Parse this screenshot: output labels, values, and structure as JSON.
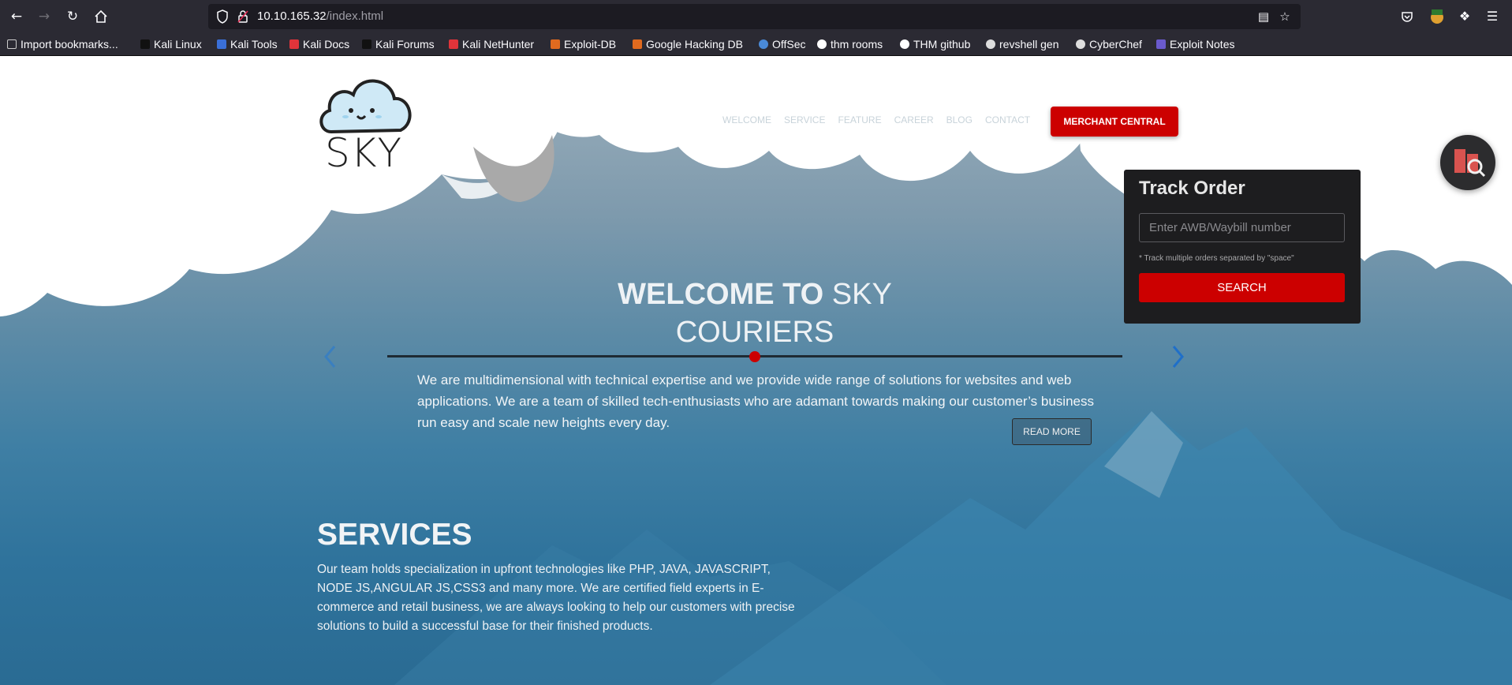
{
  "browser": {
    "url_host": "10.10.165.32",
    "url_path": "/index.html",
    "bookmarks": [
      {
        "label": "Import bookmarks...",
        "color": "#cccccc"
      },
      {
        "label": "Kali Linux",
        "color": "#1a1a1a"
      },
      {
        "label": "Kali Tools",
        "color": "#3a6fd8"
      },
      {
        "label": "Kali Docs",
        "color": "#e0343a"
      },
      {
        "label": "Kali Forums",
        "color": "#1a1a1a"
      },
      {
        "label": "Kali NetHunter",
        "color": "#e0343a"
      },
      {
        "label": "Exploit-DB",
        "color": "#e06a1f"
      },
      {
        "label": "Google Hacking DB",
        "color": "#e06a1f"
      },
      {
        "label": "OffSec",
        "color": "#4a8ad8"
      },
      {
        "label": "thm rooms",
        "color": "#ffffff"
      },
      {
        "label": "THM github",
        "color": "#ffffff"
      },
      {
        "label": "revshell gen",
        "color": "#dddddd"
      },
      {
        "label": "CyberChef",
        "color": "#dddddd"
      },
      {
        "label": "Exploit Notes",
        "color": "#6a5acd"
      }
    ]
  },
  "site": {
    "logo_text": "SKY",
    "nav": [
      "WELCOME",
      "SERVICE",
      "FEATURE",
      "CAREER",
      "BLOG",
      "CONTACT"
    ],
    "merchant_button": "MERCHANT CENTRAL"
  },
  "track": {
    "title": "Track Order",
    "placeholder": "Enter AWB/Waybill number",
    "hint": "* Track multiple orders separated by \"space\"",
    "search_label": "SEARCH"
  },
  "hero": {
    "title_bold": "WELCOME TO",
    "title_light_1": "SKY",
    "title_light_2": "COURIERS",
    "body": "We are multidimensional with technical expertise and we provide wide range of solutions for websites and web applications. We are a team of skilled tech-enthusiasts who are adamant towards making our customer’s business run easy and scale new heights every day.",
    "read_more": "READ MORE"
  },
  "services": {
    "title": "SERVICES",
    "body": "Our team holds specialization in upfront technologies like PHP, JAVA, JAVASCRIPT, NODE JS,ANGULAR JS,CSS3 and many more. We are certified field experts in E-commerce and retail business, we are always looking to help our customers with precise solutions to build a successful base for their finished products."
  },
  "colors": {
    "accent": "#cc0000",
    "browser_bg": "#2b2a33",
    "track_bg": "#1d1d1f"
  }
}
